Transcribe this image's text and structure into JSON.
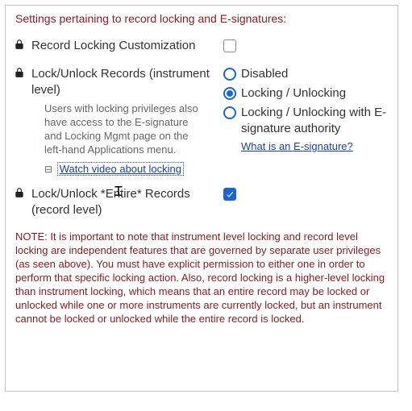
{
  "panel": {
    "title": "Settings pertaining to record locking and E-signatures:"
  },
  "recordLockingCustomization": {
    "label": "Record Locking Customization",
    "checked": false
  },
  "lockUnlockInstrument": {
    "label": "Lock/Unlock Records (instrument level)",
    "help": "Users with locking privileges also have access to the E-signature and Locking Mgmt page on the left-hand Applications menu.",
    "videoLinkText": "Watch video about locking",
    "options": {
      "disabled": {
        "label": "Disabled",
        "selected": false
      },
      "locking": {
        "label": "Locking / Unlocking",
        "selected": true
      },
      "esig": {
        "label": "Locking / Unlocking with E-signature authority",
        "selected": false
      }
    },
    "esigHelpLink": "What is an E-signature?"
  },
  "lockUnlockEntire": {
    "label": "Lock/Unlock *Entire* Records (record level)",
    "checked": true
  },
  "note": "NOTE: It is important to note that instrument level locking and record level locking are independent features that are governed by separate user privileges (as seen above). You must have explicit permission to either one in order to perform that specific locking action. Also, record locking is a higher-level locking than instrument locking, which means that an entire record may be locked or unlocked while one or more instruments are currently locked, but an instrument cannot be locked or unlocked while the entire record is locked."
}
